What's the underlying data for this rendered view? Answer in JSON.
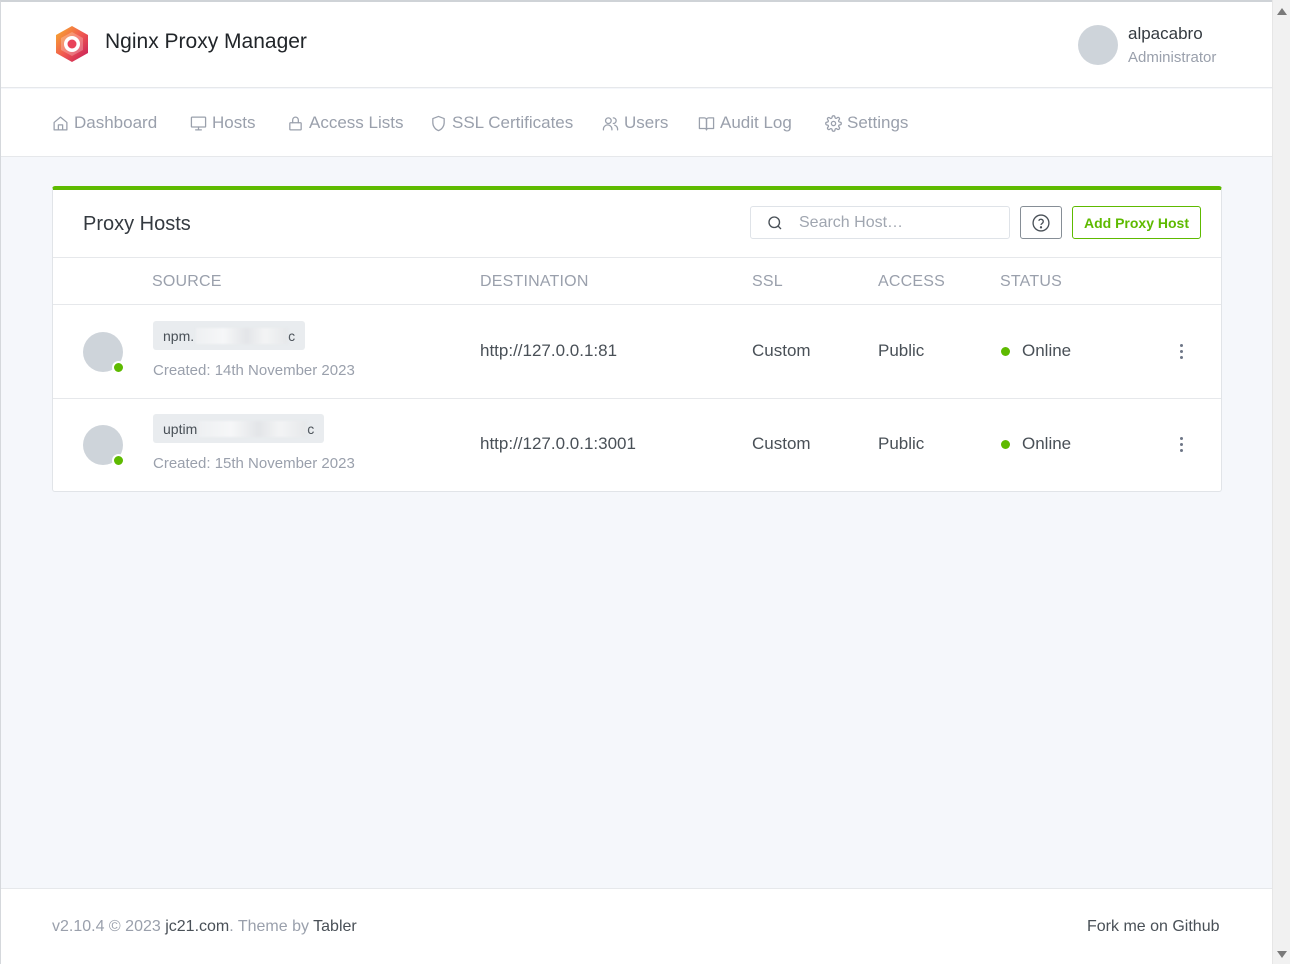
{
  "header": {
    "brand": "Nginx Proxy Manager",
    "user": {
      "name": "alpacabro",
      "role": "Administrator"
    }
  },
  "nav": [
    {
      "label": "Dashboard",
      "icon": "home-icon"
    },
    {
      "label": "Hosts",
      "icon": "monitor-icon"
    },
    {
      "label": "Access Lists",
      "icon": "lock-icon"
    },
    {
      "label": "SSL Certificates",
      "icon": "shield-icon"
    },
    {
      "label": "Users",
      "icon": "users-icon"
    },
    {
      "label": "Audit Log",
      "icon": "book-icon"
    },
    {
      "label": "Settings",
      "icon": "gear-icon"
    }
  ],
  "card": {
    "title": "Proxy Hosts",
    "search_placeholder": "Search Host…",
    "add_button": "Add Proxy Host",
    "columns": {
      "source": "SOURCE",
      "destination": "DESTINATION",
      "ssl": "SSL",
      "access": "ACCESS",
      "status": "STATUS"
    },
    "rows": [
      {
        "source_prefix": "npm.",
        "source_suffix": "c",
        "created": "Created: 14th November 2023",
        "destination": "http://127.0.0.1:81",
        "ssl": "Custom",
        "access": "Public",
        "status": "Online"
      },
      {
        "source_prefix": "uptim",
        "source_suffix": "c",
        "created": "Created: 15th November 2023",
        "destination": "http://127.0.0.1:3001",
        "ssl": "Custom",
        "access": "Public",
        "status": "Online"
      }
    ]
  },
  "footer": {
    "version": "v2.10.4 © 2023",
    "site_link": "jc21.com",
    "theme_by": ". Theme by",
    "theme_link": "Tabler",
    "github": "Fork me on Github"
  },
  "colors": {
    "accent": "#5eba00",
    "muted": "#9aa0ac",
    "text": "#495057"
  }
}
